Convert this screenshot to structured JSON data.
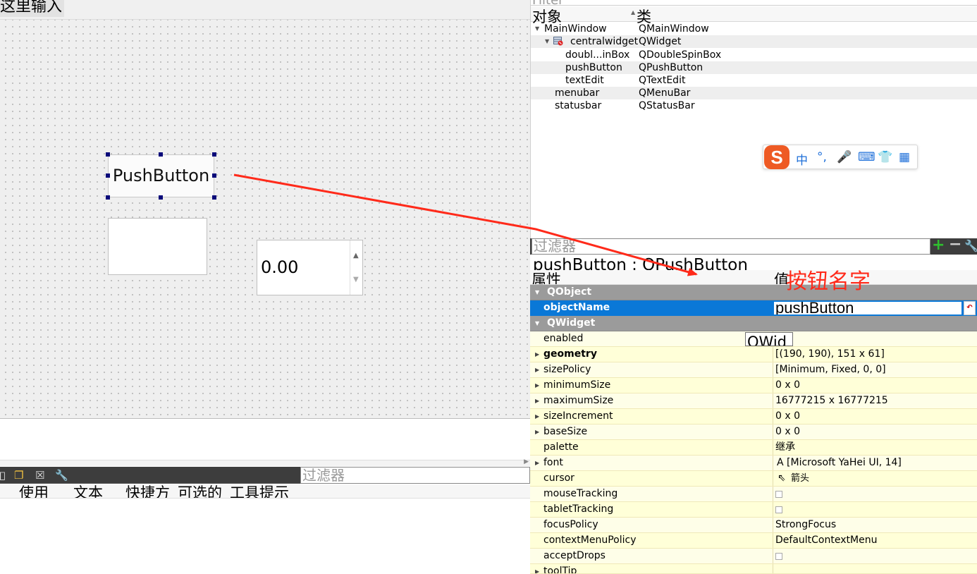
{
  "designer": {
    "menu_placeholder": "这里输入",
    "push_button_label": "PushButton",
    "spin_value": "0.00"
  },
  "action_editor": {
    "filter_placeholder": "过滤器",
    "columns": [
      "使用",
      "文本",
      "快捷方",
      "可选的",
      "工具提示"
    ]
  },
  "object_inspector": {
    "filter_placeholder": "Filter",
    "header_object": "对象",
    "header_class": "类",
    "rows": [
      {
        "name": "MainWindow",
        "class": "QMainWindow"
      },
      {
        "name": "centralwidget",
        "class": "QWidget"
      },
      {
        "name": "doubl...inBox",
        "class": "QDoubleSpinBox"
      },
      {
        "name": "pushButton",
        "class": "QPushButton"
      },
      {
        "name": "textEdit",
        "class": "QTextEdit"
      },
      {
        "name": "menubar",
        "class": "QMenuBar"
      },
      {
        "name": "statusbar",
        "class": "QStatusBar"
      }
    ]
  },
  "ime_toolbar": {
    "logo": "S",
    "items": [
      "中",
      "°,",
      "🎤",
      "⌨",
      "👕",
      "▦"
    ]
  },
  "property_editor": {
    "filter_placeholder": "过滤器",
    "object_label": "pushButton : QPushButton",
    "header_property": "属性",
    "header_value": "值",
    "groups": {
      "qobject": "QObject",
      "qwidget": "QWidget"
    },
    "object_name": {
      "name": "objectName",
      "value": "pushButton"
    },
    "enabled_popup": "QWid",
    "rows": [
      {
        "name": "enabled",
        "value": ""
      },
      {
        "name": "geometry",
        "value": "[(190, 190), 151 x 61]"
      },
      {
        "name": "sizePolicy",
        "value": "[Minimum, Fixed, 0, 0]"
      },
      {
        "name": "minimumSize",
        "value": "0 x 0"
      },
      {
        "name": "maximumSize",
        "value": "16777215 x 16777215"
      },
      {
        "name": "sizeIncrement",
        "value": "0 x 0"
      },
      {
        "name": "baseSize",
        "value": "0 x 0"
      },
      {
        "name": "palette",
        "value": "继承"
      },
      {
        "name": "font",
        "value": "A  [Microsoft YaHei UI, 14]"
      },
      {
        "name": "cursor",
        "value": "箭头"
      },
      {
        "name": "mouseTracking",
        "value": ""
      },
      {
        "name": "tabletTracking",
        "value": ""
      },
      {
        "name": "focusPolicy",
        "value": "StrongFocus"
      },
      {
        "name": "contextMenuPolicy",
        "value": "DefaultContextMenu"
      },
      {
        "name": "acceptDrops",
        "value": ""
      },
      {
        "name": "toolTip",
        "value": ""
      }
    ]
  },
  "annotation": {
    "label": "按钮名字",
    "color": "#ff2a1a"
  },
  "colors": {
    "selection": "#0a78d7",
    "group_header": "#9b9b9b",
    "property_row": "#ffffd8"
  }
}
